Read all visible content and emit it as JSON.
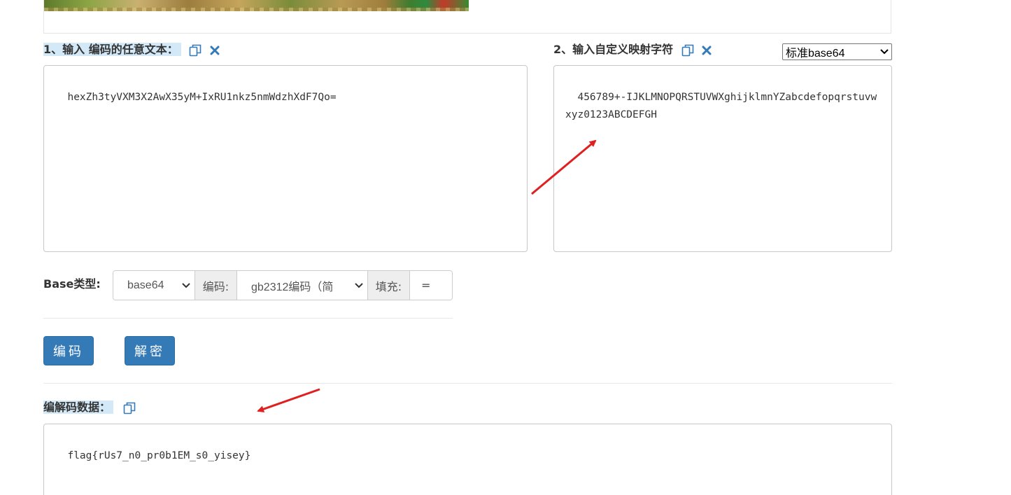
{
  "input_section": {
    "label": "1、输入 编码的任意文本：",
    "text": "hexZh3tyVXM3X2AwX35yM+IxRU1nkz5nmWdzhXdF7Qo="
  },
  "mapping_section": {
    "label": "2、输入自定义映射字符",
    "preset_selected": "标准base64",
    "text": "456789+-IJKLMNOPQRSTUVWXghijklmnYZabcdefopqrstuvwxyz0123ABCDEFGH"
  },
  "options": {
    "base_type_label": "Base类型:",
    "base_type_value": "base64",
    "encoding_label": "编码:",
    "encoding_value": "gb2312编码（简",
    "padding_label": "填充:",
    "padding_value": "="
  },
  "buttons": {
    "encode_label": "编码",
    "decode_label": "解密"
  },
  "output_section": {
    "label": "编解码数据：",
    "text": "flag{rUs7_n0_pr0b1EM_s0_yisey}"
  },
  "icons": [
    "copy-icon",
    "clear-icon",
    "chevron-down-icon",
    "resize-grip-icon",
    "annotation-arrow"
  ],
  "colors": {
    "accent": "#337ab7",
    "label_highlight": "#d4e9f7",
    "annotation_arrow": "#e02020"
  }
}
